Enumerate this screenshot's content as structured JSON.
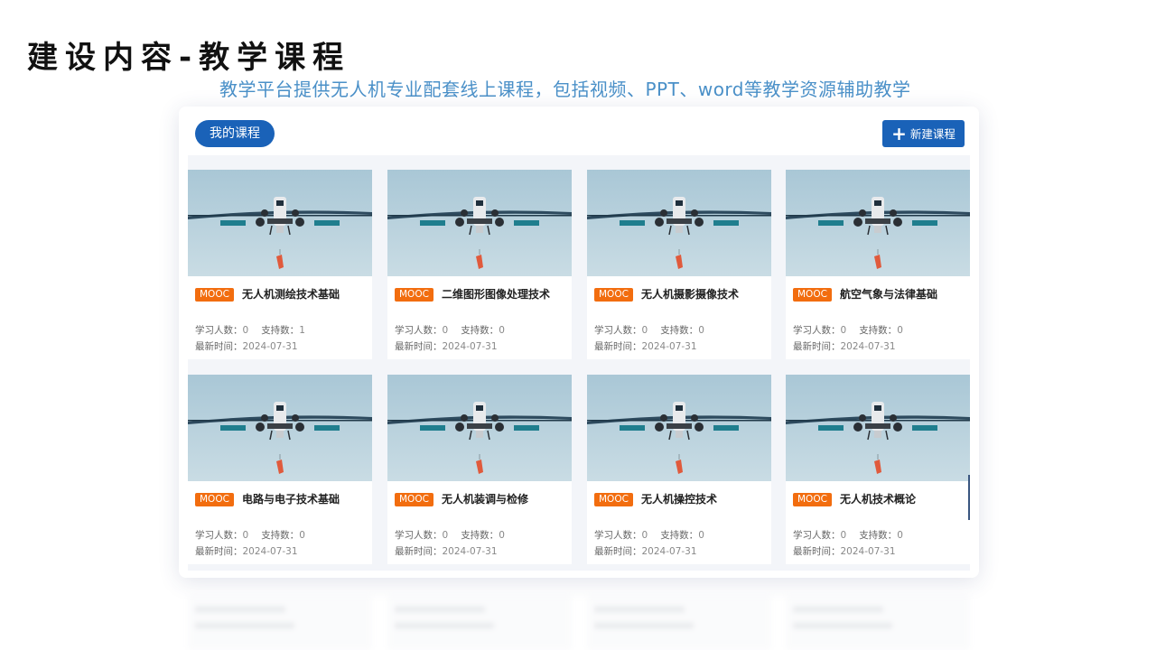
{
  "slide": {
    "title": "建设内容-教学课程",
    "subtitle": "教学平台提供无人机专业配套线上课程，包括视频、PPT、word等教学资源辅助教学"
  },
  "toolbar": {
    "tab_mine": "我的课程",
    "new_course_icon": "plus-icon",
    "new_course_label": "新建课程"
  },
  "labels": {
    "learners": "学习人数：",
    "supporters": "支持数：",
    "updated": "最新时间："
  },
  "colors": {
    "primary": "#1a62b8",
    "tag": "#f26d0f",
    "subtitle": "#4a90c8"
  },
  "courses": [
    {
      "tag": "MOOC",
      "title": "无人机测绘技术基础",
      "learners": "0",
      "supporters": "1",
      "date": "2024-07-31"
    },
    {
      "tag": "MOOC",
      "title": "二维图形图像处理技术",
      "learners": "0",
      "supporters": "0",
      "date": "2024-07-31"
    },
    {
      "tag": "MOOC",
      "title": "无人机摄影摄像技术",
      "learners": "0",
      "supporters": "0",
      "date": "2024-07-31"
    },
    {
      "tag": "MOOC",
      "title": "航空气象与法律基础",
      "learners": "0",
      "supporters": "0",
      "date": "2024-07-31"
    },
    {
      "tag": "MOOC",
      "title": "电路与电子技术基础",
      "learners": "0",
      "supporters": "0",
      "date": "2024-07-31"
    },
    {
      "tag": "MOOC",
      "title": "无人机装调与检修",
      "learners": "0",
      "supporters": "0",
      "date": "2024-07-31"
    },
    {
      "tag": "MOOC",
      "title": "无人机操控技术",
      "learners": "0",
      "supporters": "0",
      "date": "2024-07-31"
    },
    {
      "tag": "MOOC",
      "title": "无人机技术概论",
      "learners": "0",
      "supporters": "0",
      "date": "2024-07-31"
    }
  ]
}
